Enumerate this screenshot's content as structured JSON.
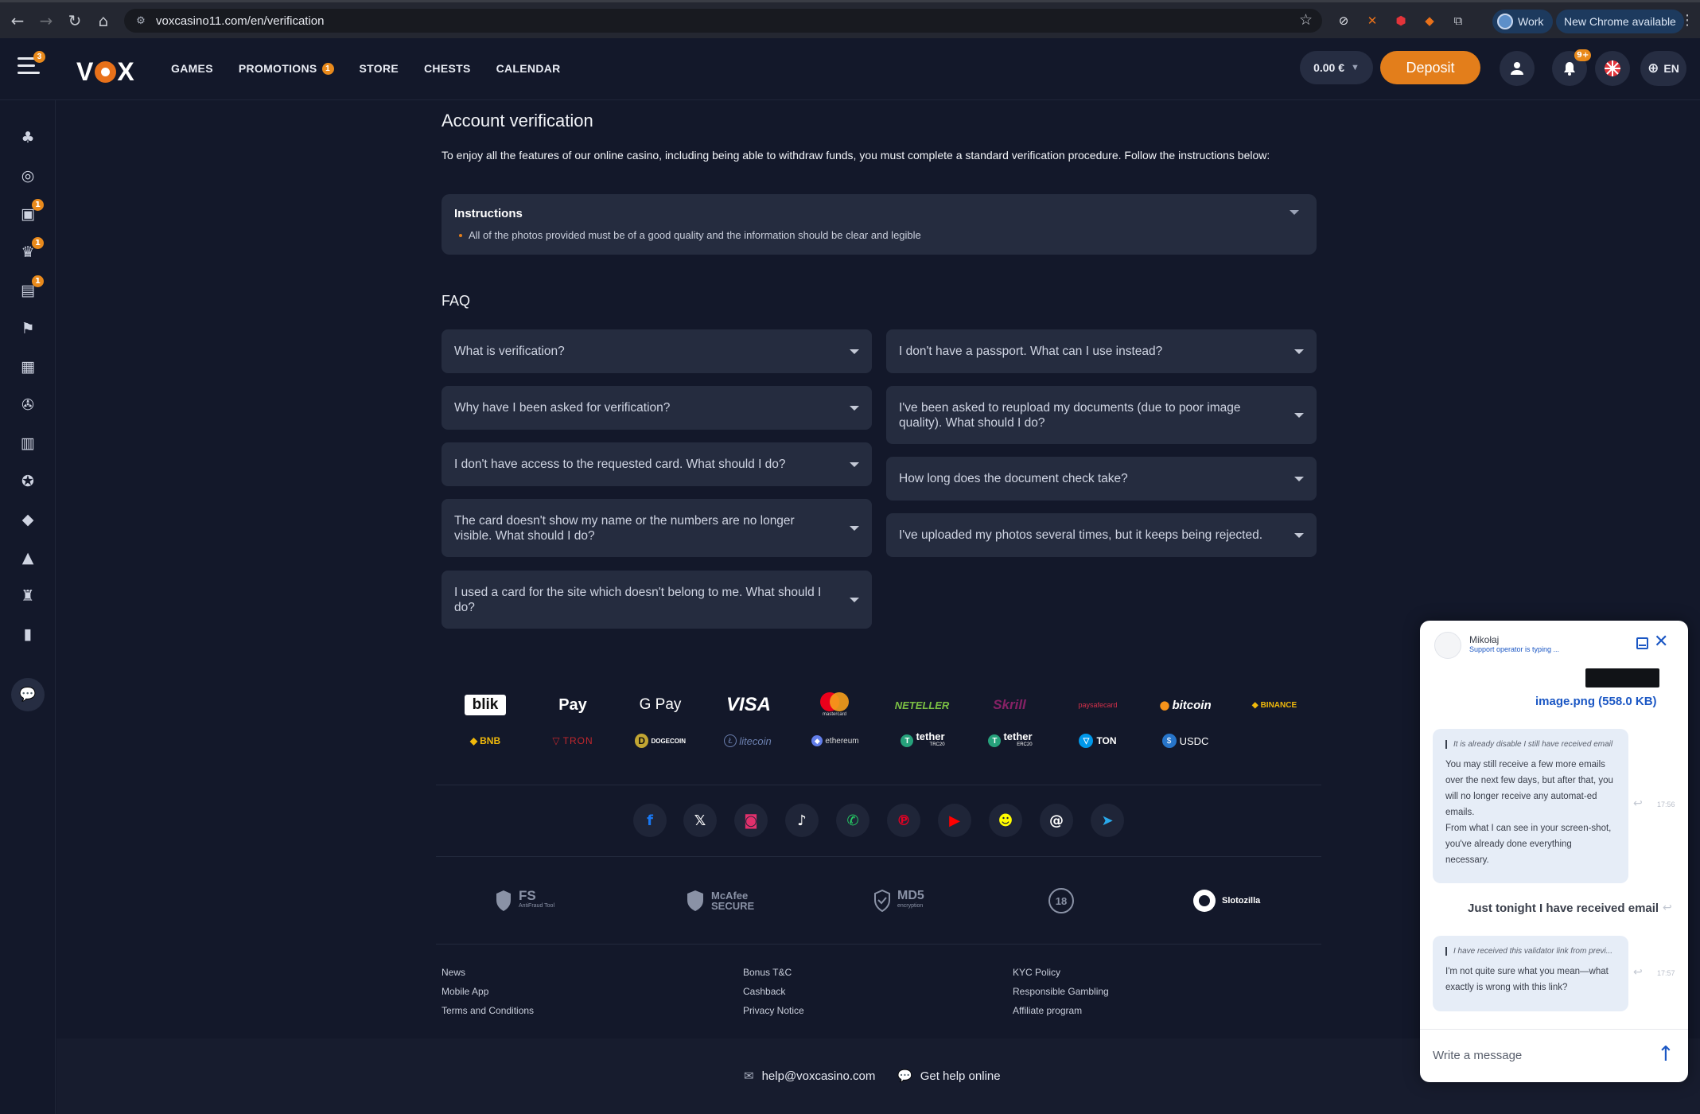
{
  "browser": {
    "url": "voxcasino11.com/en/verification",
    "profile_label": "Work",
    "update_label": "New Chrome available"
  },
  "header": {
    "menu_badge": "3",
    "logo_text": "VOX",
    "nav": [
      {
        "label": "GAMES"
      },
      {
        "label": "PROMOTIONS",
        "badge": "1"
      },
      {
        "label": "STORE"
      },
      {
        "label": "CHESTS"
      },
      {
        "label": "CALENDAR"
      }
    ],
    "balance": "0.00 €",
    "deposit_label": "Deposit",
    "notification_badge": "9+",
    "language": "EN",
    "brand_color": "#e37e1b"
  },
  "sidebar": {
    "items": [
      {
        "icon": "cherries-icon"
      },
      {
        "icon": "roulette-icon"
      },
      {
        "icon": "gift-icon",
        "badge": "1"
      },
      {
        "icon": "trophy-icon",
        "badge": "1"
      },
      {
        "icon": "chest-icon",
        "badge": "1"
      },
      {
        "icon": "race-flag-icon"
      },
      {
        "icon": "calendar-icon"
      },
      {
        "icon": "wheel-icon"
      },
      {
        "icon": "store-icon"
      },
      {
        "icon": "badge-icon"
      },
      {
        "icon": "diamond-icon"
      },
      {
        "icon": "lock-icon"
      },
      {
        "icon": "tournament-icon"
      },
      {
        "icon": "leaderboard-icon"
      }
    ],
    "chat_icon": "chat-icon"
  },
  "main": {
    "title": "Account verification",
    "intro": "To enjoy all the features of our online casino, including being able to withdraw funds, you must complete a standard verification procedure. Follow the instructions below:",
    "instructions": {
      "heading": "Instructions",
      "items": [
        "All of the photos provided must be of a good quality and the information should be clear and legible"
      ]
    },
    "faq_title": "FAQ",
    "faq_left": [
      "What is verification?",
      "Why have I been asked for verification?",
      "I don't have access to the requested card. What should I do?",
      "The card doesn't show my name or the numbers are no longer visible. What should I do?",
      "I used a card for the site which doesn't belong to me. What should I do?"
    ],
    "faq_right": [
      "I don't have a passport. What can I use instead?",
      "I've been asked to reupload my documents (due to poor image quality). What should I do?",
      "How long does the document check take?",
      "I've uploaded my photos several times, but it keeps being rejected."
    ]
  },
  "payments": {
    "row1": [
      "blik",
      "Pay",
      "G Pay",
      "VISA",
      "mastercard",
      "NETELLER",
      "Skrill",
      "paysafecard",
      "bitcoin",
      "BINANCE"
    ],
    "row2": [
      "BNB",
      "TRON",
      "DOGECOIN",
      "litecoin",
      "ethereum",
      "tether",
      "tether",
      "TON",
      "USDC"
    ],
    "tether_sub": [
      "TRC20",
      "ERC20"
    ]
  },
  "social": [
    "facebook-icon",
    "x-icon",
    "instagram-icon",
    "tiktok-icon",
    "whatsapp-icon",
    "pinterest-icon",
    "youtube-icon",
    "snapchat-icon",
    "threads-icon",
    "telegram-icon"
  ],
  "trust": {
    "fs": "FS",
    "fs_sub": "AntiFraud Tool",
    "mcafee": "McAfee SECURE",
    "md5": "MD5",
    "md5_sub": "encryption",
    "age": "18",
    "slotozilla": "Slotozilla"
  },
  "footer": {
    "col1": [
      "News",
      "Mobile App",
      "Terms and Conditions"
    ],
    "col2": [
      "Bonus T&C",
      "Cashback",
      "Privacy Notice"
    ],
    "col3": [
      "KYC Policy",
      "Responsible Gambling",
      "Affiliate program"
    ],
    "email": "help@voxcasino.com",
    "help": "Get help online"
  },
  "chat": {
    "agent_name": "Mikołaj",
    "typing": "Support operator is typing ...",
    "file_link": "image.png (558.0 KB)",
    "msg1_quote": "It is already disable I still have received email",
    "msg1_text": "You may still receive a few more emails over the next few days, but after that, you will no longer receive any automat-ed emails.\nFrom what I can see in your screen-shot, you've already done everything necessary.",
    "msg1_time": "17:56",
    "own_text": "Just tonight I have received email",
    "msg2_quote": "I have received this validator link from previ...",
    "msg2_text": "I'm not quite sure what you mean—what exactly is wrong with this link?",
    "msg2_time": "17:57",
    "placeholder": "Write a message",
    "accent": "#1b57c4"
  }
}
